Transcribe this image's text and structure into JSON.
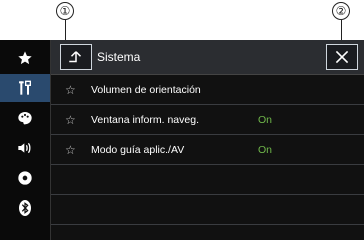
{
  "callouts": {
    "one": "①",
    "two": "②"
  },
  "sidebar": {
    "items": [
      {
        "icon": "star-icon",
        "active": false
      },
      {
        "icon": "tools-icon",
        "active": true
      },
      {
        "icon": "palette-icon",
        "active": false
      },
      {
        "icon": "speaker-icon",
        "active": false
      },
      {
        "icon": "disc-icon",
        "active": false
      },
      {
        "icon": "bluetooth-icon",
        "active": false
      }
    ]
  },
  "header": {
    "back_icon": "back-arrow-icon",
    "title": "Sistema",
    "close_icon": "close-icon"
  },
  "list": {
    "items": [
      {
        "label": "Volumen de orientación",
        "value": ""
      },
      {
        "label": "Ventana inform. naveg.",
        "value": "On"
      },
      {
        "label": "Modo guía aplic./AV",
        "value": "On"
      }
    ]
  },
  "colors": {
    "accent_value": "#6fb74a",
    "active_sidebar": "#2a4a6e",
    "background": "#111111"
  }
}
